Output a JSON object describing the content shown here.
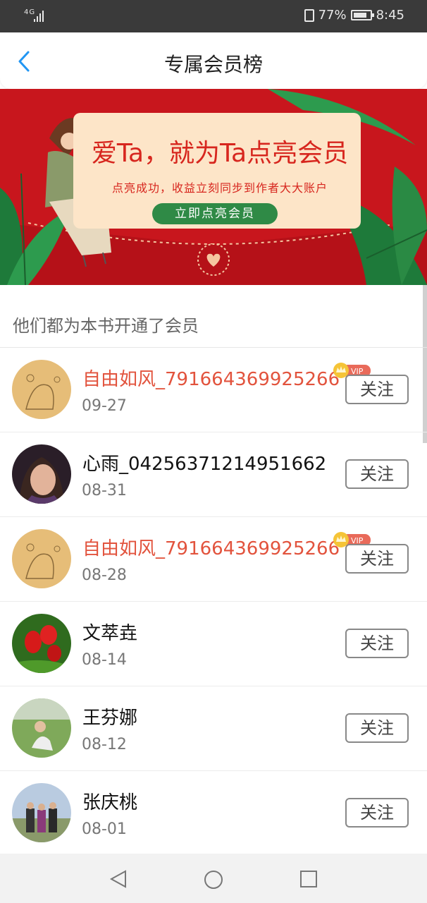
{
  "status": {
    "network": "4G",
    "battery_pct": "77%",
    "time": "8:45"
  },
  "header": {
    "title": "专属会员榜"
  },
  "banner": {
    "headline": "爱Ta，就为Ta点亮会员",
    "subtitle": "点亮成功，收益立刻同步到作者大大账户",
    "cta": "立即点亮会员"
  },
  "section_title": "他们都为本书开通了会员",
  "colors": {
    "accent": "#e2533d",
    "banner_red": "#c8161d",
    "green": "#2f8a46",
    "back_blue": "#2196f3"
  },
  "members": [
    {
      "name": "自由如风_791664369925266",
      "date": "09-27",
      "vip": true,
      "vip_label": "VIP",
      "follow": "关注"
    },
    {
      "name": "心雨_04256371214951662",
      "date": "08-31",
      "vip": false,
      "follow": "关注"
    },
    {
      "name": "自由如风_791664369925266",
      "date": "08-28",
      "vip": true,
      "vip_label": "VIP",
      "follow": "关注"
    },
    {
      "name": "文萃垚",
      "date": "08-14",
      "vip": false,
      "follow": "关注"
    },
    {
      "name": "王芬娜",
      "date": "08-12",
      "vip": false,
      "follow": "关注"
    },
    {
      "name": "张庆桃",
      "date": "08-01",
      "vip": false,
      "follow": "关注"
    }
  ],
  "icons": {
    "back": "back-chevron-icon",
    "nav_back": "triangle-back-icon",
    "nav_home": "circle-home-icon",
    "nav_recent": "square-recent-icon"
  }
}
